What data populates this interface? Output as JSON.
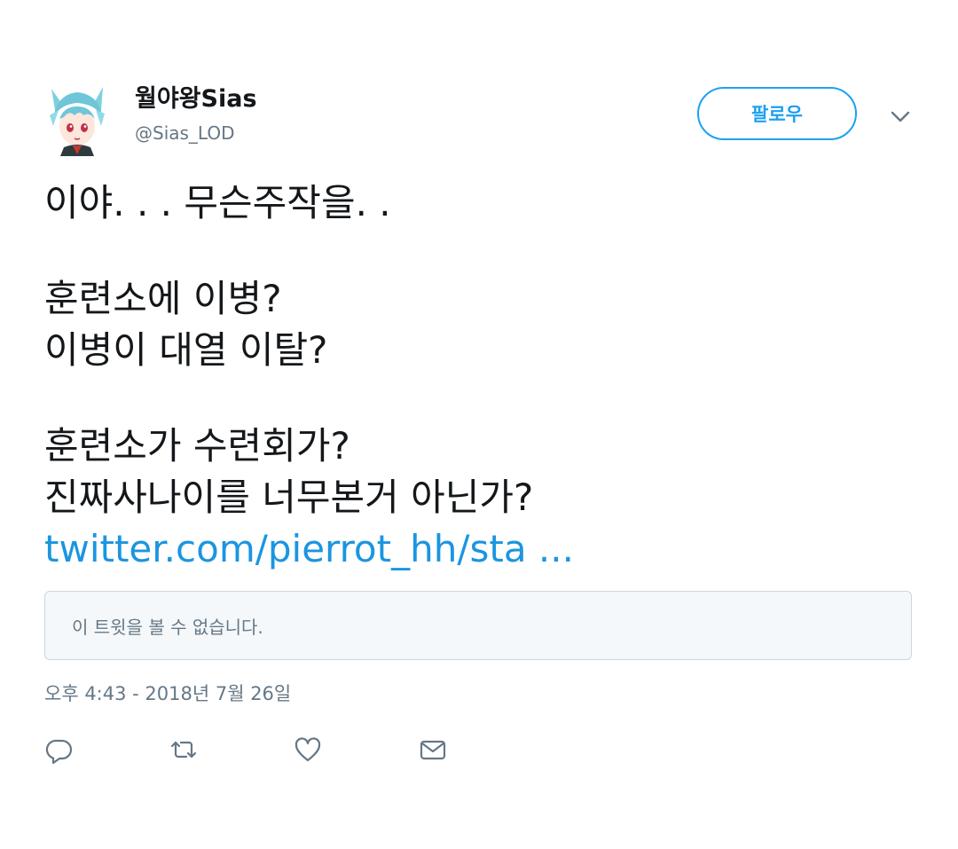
{
  "user": {
    "display_name": "월야왕Sias",
    "handle": "@Sias_LOD",
    "avatar_icon": "anime-avatar"
  },
  "follow_button": {
    "label": "팔로우"
  },
  "tweet": {
    "lines": [
      "이야. . . 무슨주작을. .",
      "훈련소에 이병?",
      "이병이 대열 이탈?",
      "훈련소가 수련회가?",
      "진짜사나이를 너무본거 아닌가?"
    ],
    "link_text": "twitter.com/pierrot_hh/sta ..."
  },
  "quoted_tweet": {
    "unavailable_text": "이 트윗을 볼 수 없습니다."
  },
  "timestamp": "오후 4:43 - 2018년 7월 26일",
  "actions": [
    {
      "icon": "reply-icon"
    },
    {
      "icon": "retweet-icon"
    },
    {
      "icon": "like-icon"
    },
    {
      "icon": "direct-message-icon"
    }
  ],
  "colors": {
    "accent": "#1da1f2",
    "link": "#1b95e0",
    "secondary_text": "#657786",
    "primary_text": "#14171a",
    "quote_background": "#f5f8fa",
    "border": "#ccd6dd"
  }
}
